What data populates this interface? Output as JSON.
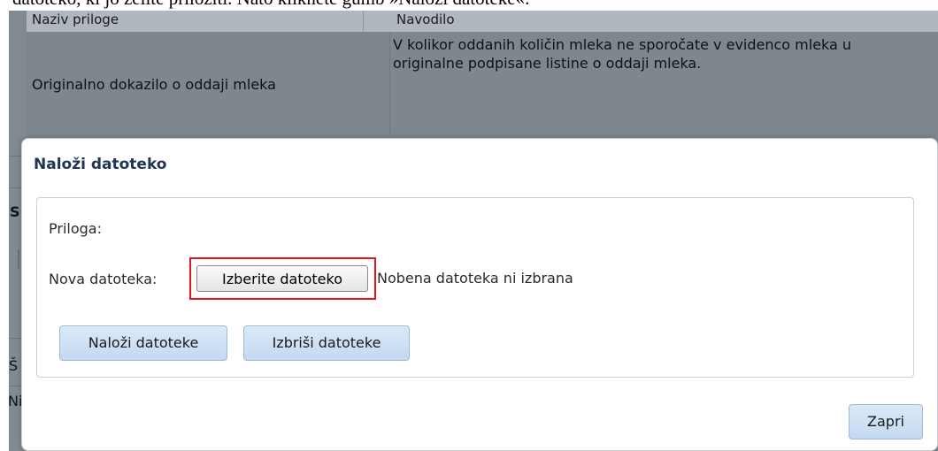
{
  "document": {
    "instruction_text": "datoteko, ki jo želite priložiti. Nato kliknete gumb »Naloži datoteke«."
  },
  "background_table": {
    "headers": [
      "Naziv priloge",
      "Navodilo"
    ],
    "rows": [
      {
        "name": "Originalno dokazilo o oddaji mleka",
        "instruction_line1": "V kolikor oddanih količin mleka ne sporočate v evidenco mleka u",
        "instruction_line2": "originalne podpisane listine o oddaji mleka."
      }
    ],
    "fragments": [
      "S",
      "Š",
      "Ni"
    ]
  },
  "modal": {
    "title": "Naloži datoteko",
    "attachment_label": "Priloga:",
    "new_file_label": "Nova datoteka:",
    "choose_file_button": "Izberite datoteko",
    "file_status": "Nobena datoteka ni izbrana",
    "upload_button": "Naloži datoteke",
    "delete_button": "Izbriši datoteke",
    "close_button": "Zapri"
  },
  "colors": {
    "highlight": "#e0161c",
    "button_fill": "#c3d9f1",
    "overlay": "#828a91"
  }
}
